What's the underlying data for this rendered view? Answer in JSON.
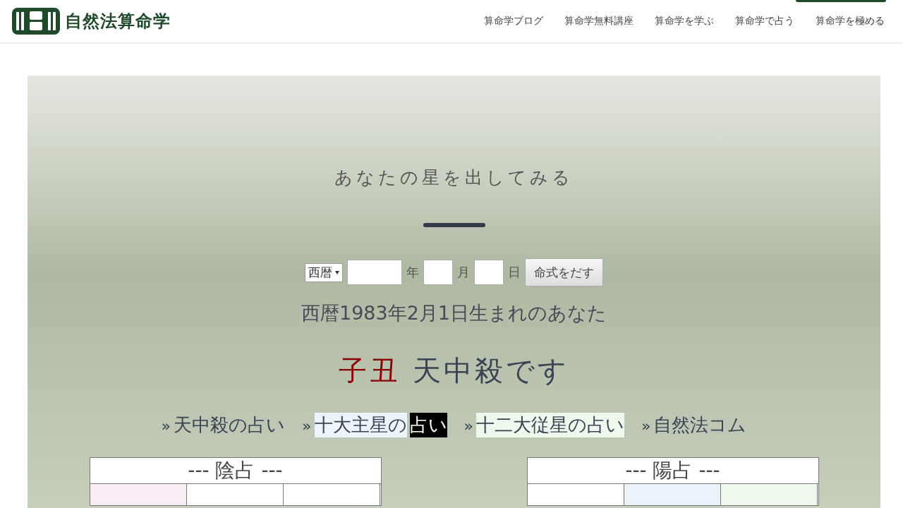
{
  "header": {
    "logo_text": "自然法算命学",
    "nav": [
      "算命学ブログ",
      "算命学無料講座",
      "算命学を学ぶ",
      "算命学で占う",
      "算命学を極める"
    ]
  },
  "hero": {
    "title": "あなたの星を出してみる",
    "form": {
      "era_select": "西暦",
      "year_unit": "年",
      "month_unit": "月",
      "day_unit": "日",
      "submit": "命式をだす"
    },
    "birth_line": "西暦1983年2月1日生まれのあなた",
    "result": {
      "highlight": "子丑",
      "rest": "天中殺です"
    },
    "links": [
      {
        "marker": "»",
        "label": "天中殺の占い"
      },
      {
        "marker": "»",
        "label": "十大主星の",
        "selected_label": "占い",
        "color": "#eef4fb"
      },
      {
        "marker": "»",
        "label": "十二大従星の占い",
        "color": "#eef8ec"
      },
      {
        "marker": "»",
        "label": "自然法コム"
      }
    ],
    "tables": [
      {
        "heading": "--- 陰占 ---",
        "cells": [
          {
            "color": "#f8ecf4"
          },
          {
            "color": "#ffffff"
          },
          {
            "color": "#ffffff"
          }
        ]
      },
      {
        "heading": "--- 陽占 ---",
        "cells": [
          {
            "color": "#ffffff"
          },
          {
            "color": "#eaf2fa"
          },
          {
            "color": "#eef8ec"
          }
        ]
      }
    ]
  }
}
